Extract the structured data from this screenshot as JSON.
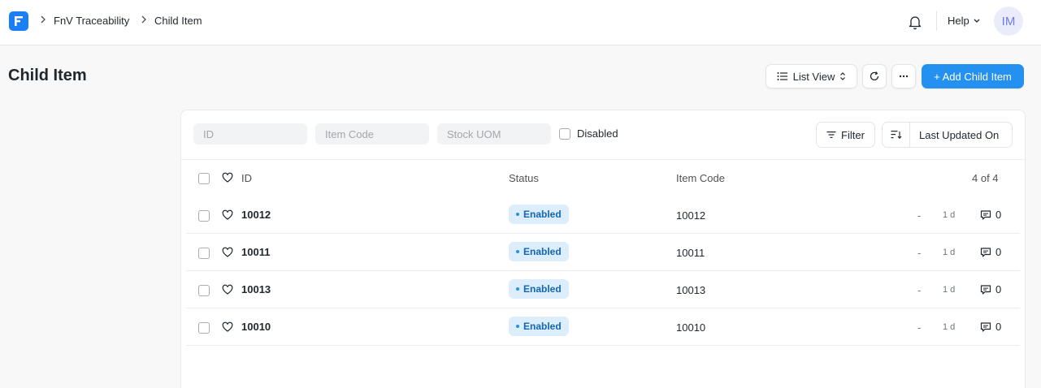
{
  "navbar": {
    "breadcrumbs": [
      "FnV Traceability",
      "Child Item"
    ],
    "help_label": "Help",
    "avatar_initials": "IM",
    "brand_color": "#1a7ef5"
  },
  "page": {
    "title": "Child Item",
    "list_view_label": "List View",
    "add_button_label": "+ Add Child Item"
  },
  "filters": {
    "id_placeholder": "ID",
    "item_code_placeholder": "Item Code",
    "stock_uom_placeholder": "Stock UOM",
    "disabled_label": "Disabled",
    "filter_label": "Filter",
    "sort_label": "Last Updated On"
  },
  "table": {
    "columns": {
      "id": "ID",
      "status": "Status",
      "item_code": "Item Code"
    },
    "count": "4 of 4",
    "rows": [
      {
        "id": "10012",
        "status": "Enabled",
        "item_code": "10012",
        "dash": "-",
        "modified": "1 d",
        "comments": "0"
      },
      {
        "id": "10011",
        "status": "Enabled",
        "item_code": "10011",
        "dash": "-",
        "modified": "1 d",
        "comments": "0"
      },
      {
        "id": "10013",
        "status": "Enabled",
        "item_code": "10013",
        "dash": "-",
        "modified": "1 d",
        "comments": "0"
      },
      {
        "id": "10010",
        "status": "Enabled",
        "item_code": "10010",
        "dash": "-",
        "modified": "1 d",
        "comments": "0"
      }
    ]
  }
}
